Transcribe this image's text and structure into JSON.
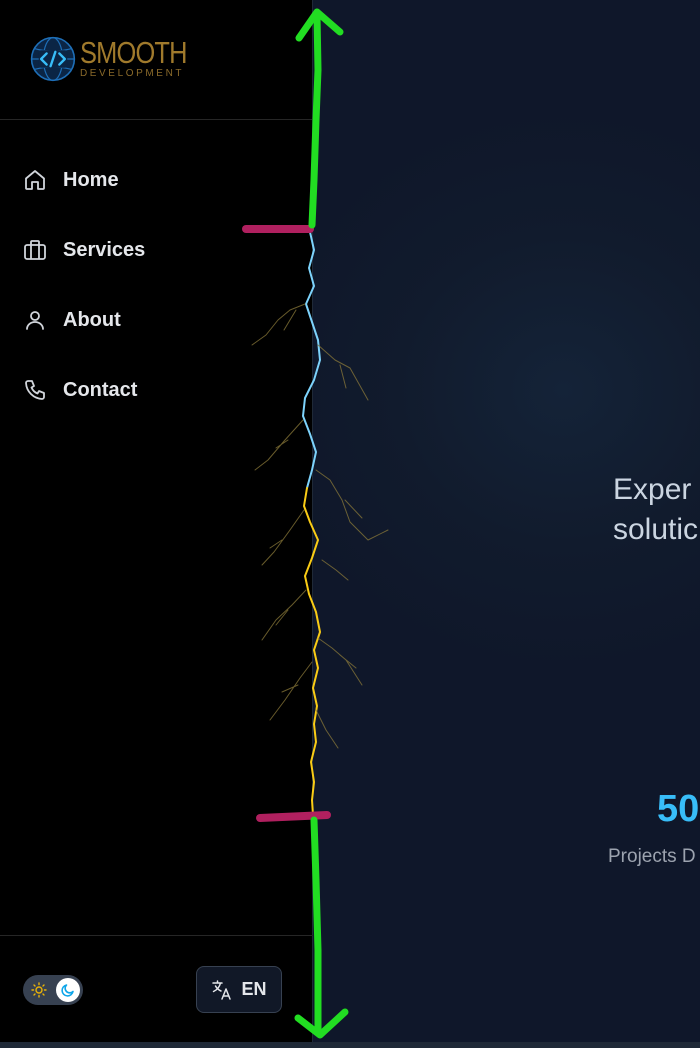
{
  "logo": {
    "name": "SMOOTH",
    "subtitle": "DEVELOPMENT"
  },
  "nav": {
    "items": [
      {
        "label": "Home",
        "icon": "home-icon"
      },
      {
        "label": "Services",
        "icon": "briefcase-icon"
      },
      {
        "label": "About",
        "icon": "user-icon"
      },
      {
        "label": "Contact",
        "icon": "phone-icon"
      }
    ]
  },
  "theme_toggle": {
    "mode": "dark",
    "icons": [
      "sun-icon",
      "moon-icon"
    ]
  },
  "language": {
    "label": "EN",
    "icon": "translate-icon"
  },
  "hero": {
    "tagline_line1": "Exper",
    "tagline_line2": "solutic"
  },
  "stats": {
    "value": "50",
    "label": "Projects D"
  },
  "colors": {
    "accent": "#38bdf8",
    "sidebar_bg": "#000000",
    "main_bg": "#0f172a",
    "annotation_arrow": "#22dd22",
    "annotation_marker": "#b0205f",
    "lightning_blue": "#7dd3fc",
    "lightning_yellow": "#facc15"
  }
}
